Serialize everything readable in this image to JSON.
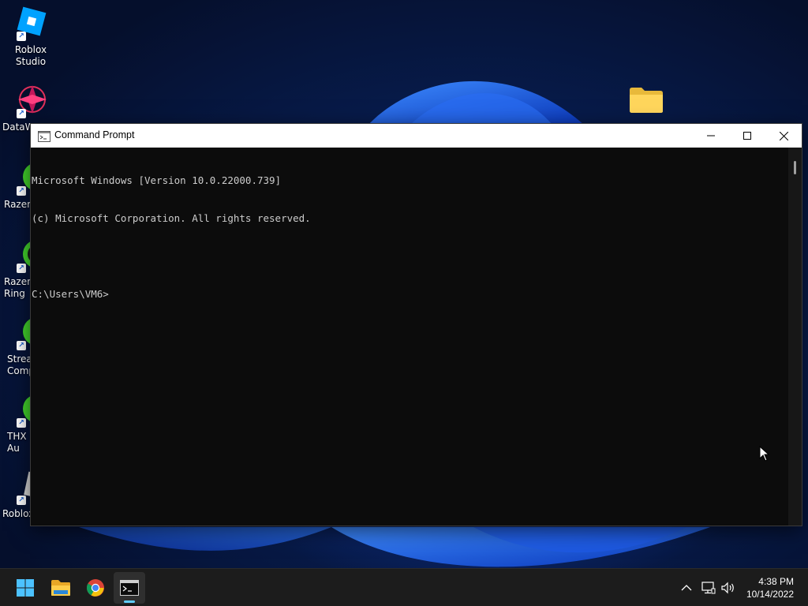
{
  "desktop": {
    "icons": [
      {
        "label": "Roblox Studio",
        "icon": "roblox-studio-icon"
      },
      {
        "label": "DataW",
        "icon": "datawing-icon"
      },
      {
        "label": "Razer",
        "icon": "razer-icon"
      },
      {
        "label": "Razer\nRing",
        "icon": "razer-icon"
      },
      {
        "label": "Strea\nComp",
        "icon": "razer-icon"
      },
      {
        "label": "THX S\nAu",
        "icon": "razer-icon"
      },
      {
        "label": "Roblox",
        "icon": "roblox-icon"
      }
    ]
  },
  "window": {
    "title": "Command Prompt",
    "console_lines": [
      "Microsoft Windows [Version 10.0.22000.739]",
      "(c) Microsoft Corporation. All rights reserved.",
      "",
      "C:\\Users\\VM6>"
    ]
  },
  "taskbar": {
    "apps": [
      "start-icon",
      "file-explorer-icon",
      "chrome-icon",
      "command-prompt-icon"
    ],
    "clock": {
      "time": "4:38 PM",
      "date": "10/14/2022"
    }
  },
  "colors": {
    "console_bg": "#0c0c0c",
    "console_text": "#cccccc",
    "taskbar_bg": "#1c1c1c",
    "accent": "#60cdff",
    "razer_green": "#44d62c"
  }
}
